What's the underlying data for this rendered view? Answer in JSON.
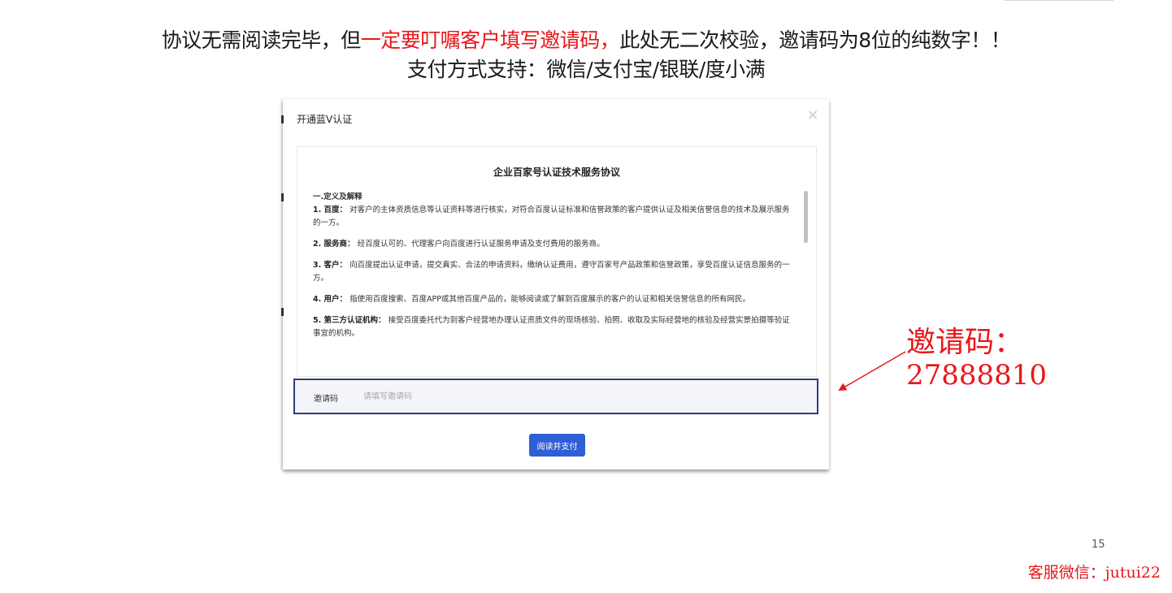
{
  "instructions": {
    "line1_prefix": "协议无需阅读完毕，但",
    "line1_highlight": "一定要叮嘱客户填写邀请码，",
    "line1_suffix": "此处无二次校验，邀请码为8位的纯数字！！",
    "line2": "支付方式支持：微信/支付宝/银联/度小满"
  },
  "dialog": {
    "title": "开通蓝V认证",
    "close_icon": "close-icon",
    "agreement": {
      "title": "企业百家号认证技术服务协议",
      "section_heading": "一.定义及解释",
      "items": [
        {
          "term": "1. 百度：",
          "text": "对客户的主体资质信息等认证资料等进行核实，对符合百度认证标准和信誉政策的客户提供认证及相关信誉信息的技术及展示服务的一方。"
        },
        {
          "term": "2. 服务商：",
          "text": "经百度认可的、代理客户向百度进行认证服务申请及支付费用的服务商。"
        },
        {
          "term": "3. 客户：",
          "text": "向百度提出认证申请，提交真实、合法的申请资料，缴纳认证费用，遵守百家号产品政策和信誉政策，享受百度认证信息服务的一方。"
        },
        {
          "term": "4. 用户：",
          "text": "指使用百度搜索、百度APP或其他百度产品的，能够阅读或了解到百度展示的客户的认证和相关信誉信息的所有网民。"
        },
        {
          "term": "5. 第三方认证机构：",
          "text": "接受百度委托代为到客户经营地办理认证资质文件的现场核验、拍照、收取及实际经营地的核验及经营实景拍摄等验证事宜的机构。"
        }
      ]
    },
    "invite_label": "邀请码",
    "invite_placeholder": "请填写邀请码",
    "invite_value": "",
    "pay_button": "阅读并支付"
  },
  "annotation": {
    "label": "邀请码：",
    "code": "27888810",
    "color": "#e8171b"
  },
  "footer": {
    "page_number": "15",
    "wechat": "客服微信：jutui22"
  },
  "colors": {
    "highlight_red": "#e8171b",
    "button_blue": "#2f5fd6",
    "input_border": "#2f3d7a"
  }
}
